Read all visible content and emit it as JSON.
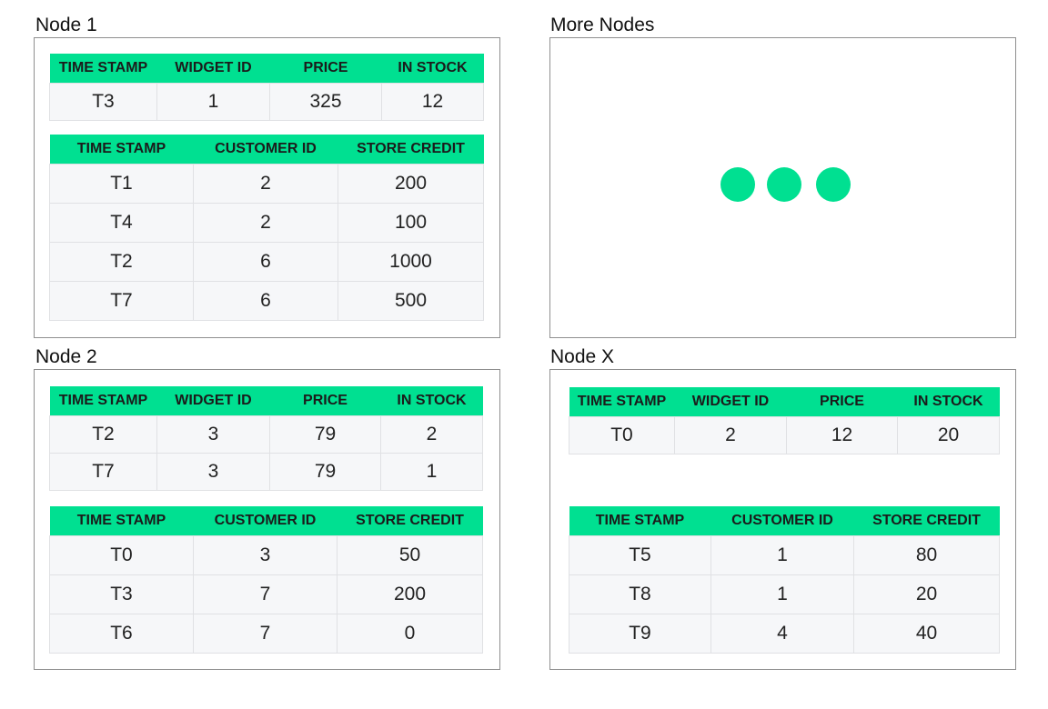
{
  "colors": {
    "header_bg": "#00e091",
    "cell_bg": "#f6f7f9",
    "border": "#8f8f8f",
    "dots": "#00e091"
  },
  "nodes": [
    {
      "title": "Node 1",
      "widgets": {
        "headers": [
          "TIME STAMP",
          "WIDGET ID",
          "PRICE",
          "IN STOCK"
        ],
        "rows": [
          [
            "T3",
            "1",
            "325",
            "12"
          ]
        ]
      },
      "customers": {
        "headers": [
          "TIME STAMP",
          "CUSTOMER ID",
          "STORE CREDIT"
        ],
        "rows": [
          [
            "T1",
            "2",
            "200"
          ],
          [
            "T4",
            "2",
            "100"
          ],
          [
            "T2",
            "6",
            "1000"
          ],
          [
            "T7",
            "6",
            "500"
          ]
        ]
      }
    },
    {
      "title": "More Nodes",
      "icon": "ellipsis-dots-icon"
    },
    {
      "title": "Node 2",
      "widgets": {
        "headers": [
          "TIME STAMP",
          "WIDGET ID",
          "PRICE",
          "IN STOCK"
        ],
        "rows": [
          [
            "T2",
            "3",
            "79",
            "2"
          ],
          [
            "T7",
            "3",
            "79",
            "1"
          ]
        ]
      },
      "customers": {
        "headers": [
          "TIME STAMP",
          "CUSTOMER ID",
          "STORE CREDIT"
        ],
        "rows": [
          [
            "T0",
            "3",
            "50"
          ],
          [
            "T3",
            "7",
            "200"
          ],
          [
            "T6",
            "7",
            "0"
          ]
        ]
      }
    },
    {
      "title": "Node X",
      "widgets": {
        "headers": [
          "TIME STAMP",
          "WIDGET ID",
          "PRICE",
          "IN STOCK"
        ],
        "rows": [
          [
            "T0",
            "2",
            "12",
            "20"
          ]
        ]
      },
      "customers": {
        "headers": [
          "TIME STAMP",
          "CUSTOMER ID",
          "STORE CREDIT"
        ],
        "rows": [
          [
            "T5",
            "1",
            "80"
          ],
          [
            "T8",
            "1",
            "20"
          ],
          [
            "T9",
            "4",
            "40"
          ]
        ]
      }
    }
  ]
}
